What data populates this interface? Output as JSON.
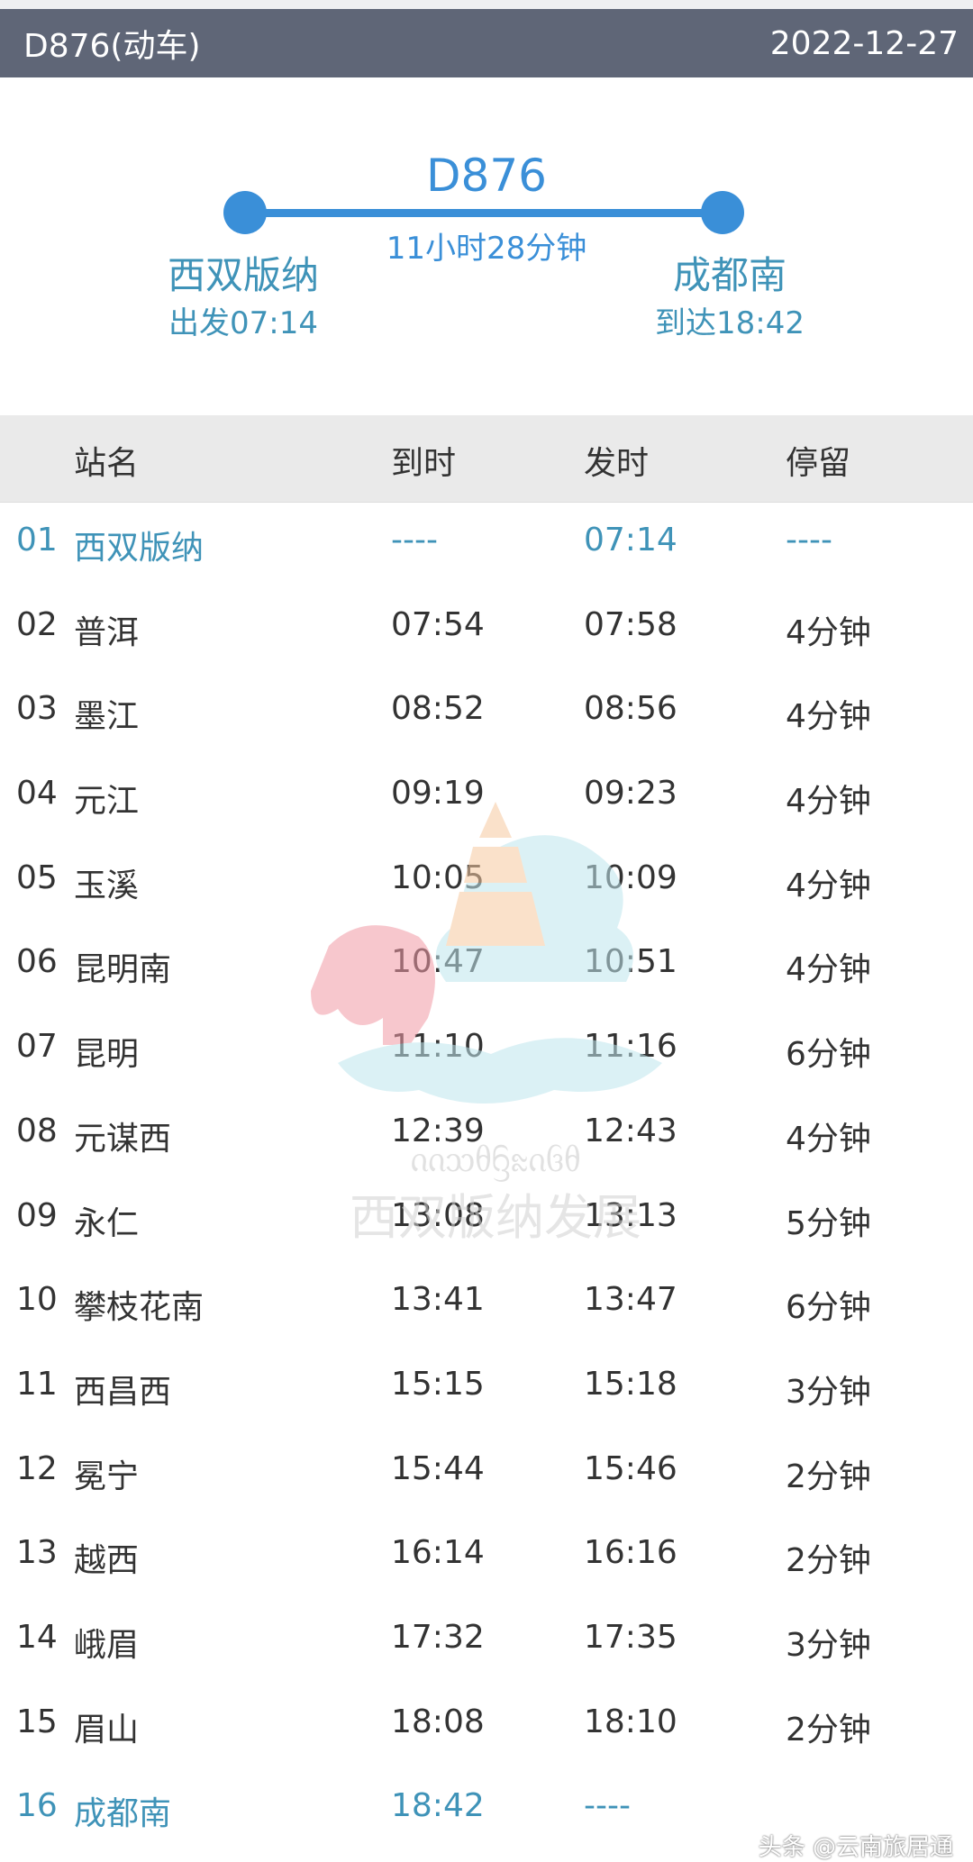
{
  "header": {
    "title": "D876(动车)",
    "date": "2022-12-27"
  },
  "summary": {
    "train_no": "D876",
    "duration": "11小时28分钟",
    "from_station": "西双版纳",
    "from_time": "出发07:14",
    "to_station": "成都南",
    "to_time": "到达18:42"
  },
  "table": {
    "headers": {
      "name": "站名",
      "arrive": "到时",
      "depart": "发时",
      "stay": "停留"
    },
    "rows": [
      {
        "no": "01",
        "name": "西双版纳",
        "arrive": "----",
        "depart": "07:14",
        "stay": "----"
      },
      {
        "no": "02",
        "name": "普洱",
        "arrive": "07:54",
        "depart": "07:58",
        "stay": "4分钟"
      },
      {
        "no": "03",
        "name": "墨江",
        "arrive": "08:52",
        "depart": "08:56",
        "stay": "4分钟"
      },
      {
        "no": "04",
        "name": "元江",
        "arrive": "09:19",
        "depart": "09:23",
        "stay": "4分钟"
      },
      {
        "no": "05",
        "name": "玉溪",
        "arrive": "10:05",
        "depart": "10:09",
        "stay": "4分钟"
      },
      {
        "no": "06",
        "name": "昆明南",
        "arrive": "10:47",
        "depart": "10:51",
        "stay": "4分钟"
      },
      {
        "no": "07",
        "name": "昆明",
        "arrive": "11:10",
        "depart": "11:16",
        "stay": "6分钟"
      },
      {
        "no": "08",
        "name": "元谋西",
        "arrive": "12:39",
        "depart": "12:43",
        "stay": "4分钟"
      },
      {
        "no": "09",
        "name": "永仁",
        "arrive": "13:08",
        "depart": "13:13",
        "stay": "5分钟"
      },
      {
        "no": "10",
        "name": "攀枝花南",
        "arrive": "13:41",
        "depart": "13:47",
        "stay": "6分钟"
      },
      {
        "no": "11",
        "name": "西昌西",
        "arrive": "15:15",
        "depart": "15:18",
        "stay": "3分钟"
      },
      {
        "no": "12",
        "name": "冕宁",
        "arrive": "15:44",
        "depart": "15:46",
        "stay": "2分钟"
      },
      {
        "no": "13",
        "name": "越西",
        "arrive": "16:14",
        "depart": "16:16",
        "stay": "2分钟"
      },
      {
        "no": "14",
        "name": "峨眉",
        "arrive": "17:32",
        "depart": "17:35",
        "stay": "3分钟"
      },
      {
        "no": "15",
        "name": "眉山",
        "arrive": "18:08",
        "depart": "18:10",
        "stay": "2分钟"
      },
      {
        "no": "16",
        "name": "成都南",
        "arrive": "18:42",
        "depart": "----",
        "stay": ""
      }
    ]
  },
  "watermark": {
    "script_text": "ᦶᦉᦲᦌᦰᦵᦑᦲ",
    "caption": "西双版纳发展"
  },
  "credit": "头条 @云南旅居通",
  "colors": {
    "header_bg": "#5f6677",
    "accent_blue": "#3a8fd8",
    "terminal_teal": "#3f93b8",
    "table_head_bg": "#eaeaea"
  }
}
